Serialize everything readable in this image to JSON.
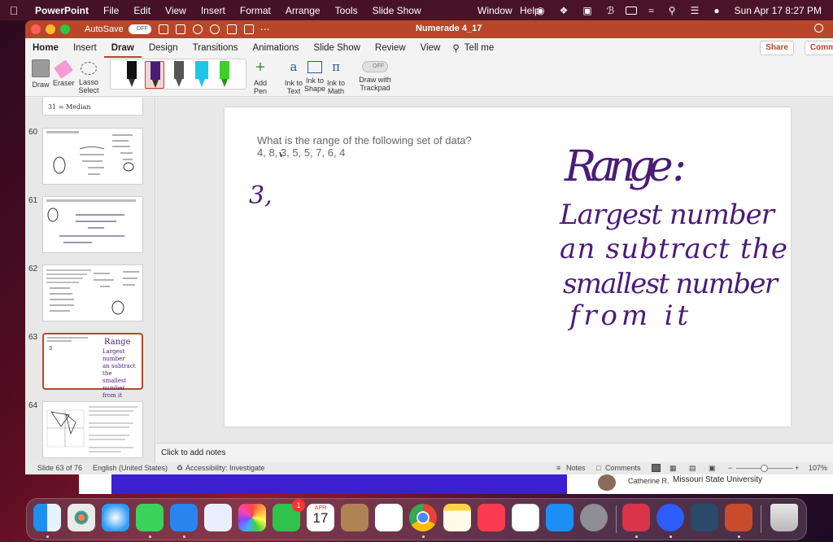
{
  "menubar": {
    "app": "PowerPoint",
    "items": [
      "File",
      "Edit",
      "View",
      "Insert",
      "Format",
      "Arrange",
      "Tools",
      "Slide Show"
    ],
    "window": "Window",
    "help": "Help",
    "clock": "Sun Apr 17  8:27 PM"
  },
  "titlebar": {
    "autosave": "AutoSave",
    "autosave_state": "OFF",
    "doc_title": "Numerade 4_17"
  },
  "tabs": [
    "Home",
    "Insert",
    "Draw",
    "Design",
    "Transitions",
    "Animations",
    "Slide Show",
    "Review",
    "View"
  ],
  "tell_me": "Tell me",
  "share": "Share",
  "comments_btn": "Comm",
  "ribbon": {
    "draw": "Draw",
    "eraser": "Eraser",
    "lasso": "Lasso",
    "lasso2": "Select",
    "add_pen": "Add Pen",
    "ink_text_1": "Ink to",
    "ink_text_2": "Text",
    "ink_shape_1": "Ink to",
    "ink_shape_2": "Shape",
    "ink_math_1": "Ink to",
    "ink_math_2": "Math",
    "trackpad_1": "Draw with",
    "trackpad_2": "Trackpad",
    "trackpad_state": "OFF",
    "pen_colors": [
      "#222222",
      "#4a1c78",
      "#555555",
      "#1ec6e6",
      "#3fcf2a"
    ]
  },
  "thumbnails": {
    "numbers": [
      "60",
      "61",
      "62",
      "63",
      "64"
    ],
    "top_partial_text": "31 = Median",
    "slide63_lines": [
      "Range",
      "Largest number",
      "an subtract the",
      "smallest number",
      "from it"
    ]
  },
  "slide": {
    "question": "What is the range of the following set of data?",
    "dataset": "4, 8, 3, 5, 5, 7, 6, 4",
    "ink_answer": "3,",
    "ink_heading": "Range :",
    "ink_lines": [
      "Largest number",
      "an subtract the",
      "smallest number",
      "from it"
    ],
    "ink_color": "#4a1c78"
  },
  "notes_placeholder": "Click to add notes",
  "status": {
    "slide": "Slide 63 of 76",
    "language": "English (United States)",
    "accessibility": "Accessibility: Investigate",
    "notes": "Notes",
    "comments": "Comments",
    "zoom": "107%"
  },
  "behind": {
    "name": "Catherine R.",
    "school": "Missouri State University"
  },
  "dock": {
    "calendar_month": "APR",
    "calendar_day": "17",
    "facetime_badge": "1"
  }
}
